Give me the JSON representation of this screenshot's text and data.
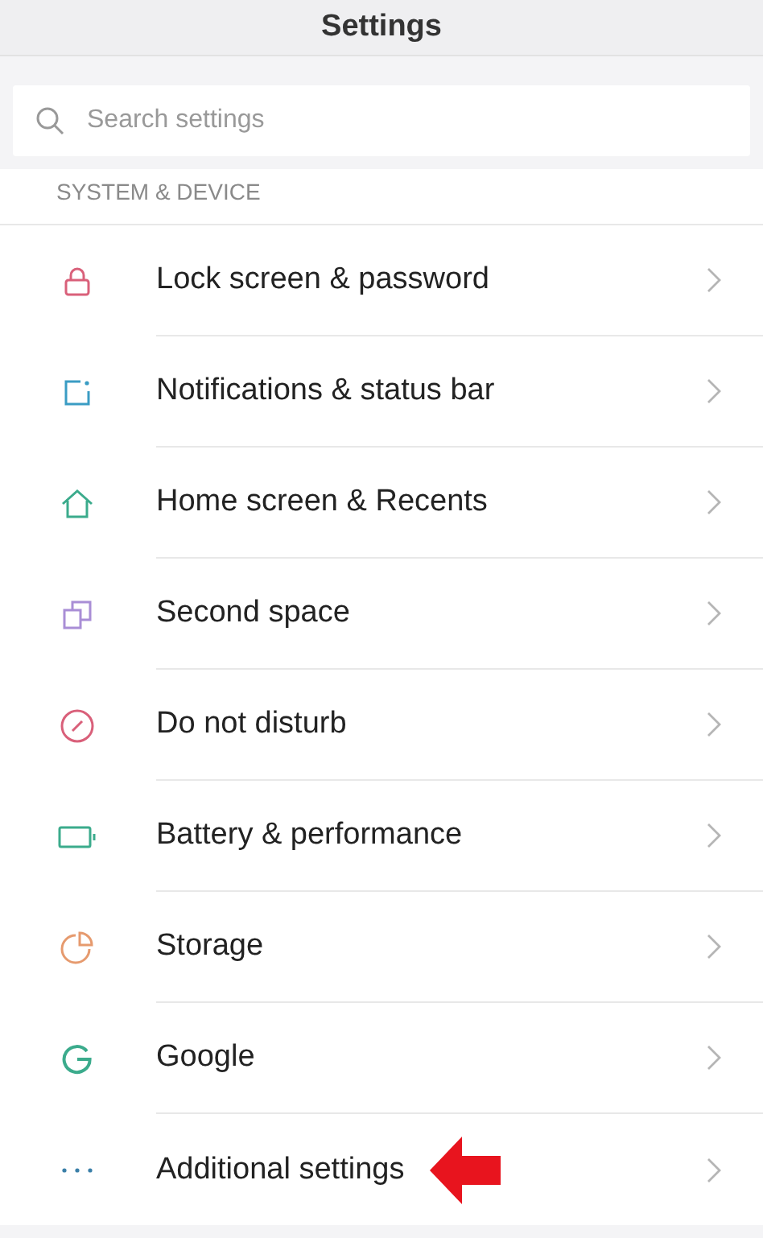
{
  "title": "Settings",
  "search": {
    "placeholder": "Search settings"
  },
  "section": "SYSTEM & DEVICE",
  "items": [
    {
      "label": "Lock screen & password",
      "kind": "lock",
      "color": "#d9607a",
      "marked": false
    },
    {
      "label": "Notifications & status bar",
      "kind": "notification",
      "color": "#3a9cc4",
      "marked": false
    },
    {
      "label": "Home screen & Recents",
      "kind": "home",
      "color": "#3bab8c",
      "marked": false
    },
    {
      "label": "Second space",
      "kind": "space",
      "color": "#a98ed6",
      "marked": false
    },
    {
      "label": "Do not disturb",
      "kind": "dnd",
      "color": "#d9607a",
      "marked": false
    },
    {
      "label": "Battery & performance",
      "kind": "battery",
      "color": "#3bab8c",
      "marked": false
    },
    {
      "label": "Storage",
      "kind": "storage",
      "color": "#e69a6e",
      "marked": false
    },
    {
      "label": "Google",
      "kind": "google",
      "color": "#3bab8c",
      "marked": false
    },
    {
      "label": "Additional settings",
      "kind": "more",
      "color": "#3a7fa8",
      "marked": true
    }
  ]
}
